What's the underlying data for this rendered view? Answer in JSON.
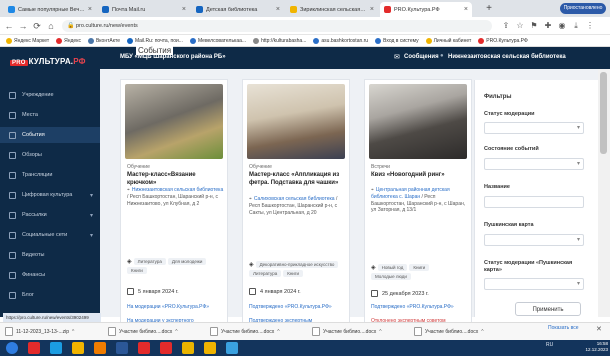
{
  "browser": {
    "tabs": [
      {
        "title": "Самые популярные Вечный эл",
        "color": "#1e88e5"
      },
      {
        "title": "Почта Mail.ru",
        "color": "#1565c0"
      },
      {
        "title": "Детская библиотека",
        "color": "#1565c0"
      },
      {
        "title": "Зириклинская сельская модел",
        "color": "#f0b400"
      },
      {
        "title": "PRO.Культура.РФ",
        "color": "#e32b2b"
      }
    ],
    "new_tab": "+",
    "url": "pro.culture.ru/new/events",
    "profile_label": "Приостановлено",
    "bookmarks": [
      {
        "label": "Яндекс Маркет",
        "color": "#f0b400"
      },
      {
        "label": "Яндекс",
        "color": "#e32b2b"
      },
      {
        "label": "ВконтАкте",
        "color": "#4a76a8"
      },
      {
        "label": "Mail.Ru: почта, пои...",
        "color": "#1565c0"
      },
      {
        "label": "Мевелсователькаа...",
        "color": "#2a6ec7"
      },
      {
        "label": "http://kulturabasha...",
        "color": "#888"
      },
      {
        "label": "asu.bashkortostan.ru",
        "color": "#2a6ec7"
      },
      {
        "label": "Вход в систему",
        "color": "#2a6ec7"
      },
      {
        "label": "Личный кабинет",
        "color": "#f0b400"
      },
      {
        "label": "PRO.Культура.РФ",
        "color": "#e32b2b"
      }
    ]
  },
  "app": {
    "logo_pro": "PRO",
    "logo_main": "КУЛЬТУРА.",
    "logo_rf": "РФ",
    "section_title": "События",
    "organization": "МБУ «МЦБ Шаранского района РБ»",
    "messages_label": "Сообщения",
    "user_org": "Нижнезаитовская сельская библиотека"
  },
  "sidebar": {
    "items": [
      {
        "label": "Учреждение",
        "active": false,
        "chevron": false
      },
      {
        "label": "Места",
        "active": false,
        "chevron": false
      },
      {
        "label": "События",
        "active": true,
        "chevron": false
      },
      {
        "label": "Обзоры",
        "active": false,
        "chevron": false
      },
      {
        "label": "Трансляции",
        "active": false,
        "chevron": false
      },
      {
        "label": "Цифровая культура",
        "active": false,
        "chevron": true
      },
      {
        "label": "Рассылки",
        "active": false,
        "chevron": true
      },
      {
        "label": "Социальные сети",
        "active": false,
        "chevron": true
      },
      {
        "label": "Видеоты",
        "active": false,
        "chevron": false
      },
      {
        "label": "Финансы",
        "active": false,
        "chevron": false
      },
      {
        "label": "Блог",
        "active": false,
        "chevron": false
      }
    ]
  },
  "cards": [
    {
      "category": "Обучение",
      "title": "Мастер-класс«Вязание крючком»",
      "address_link": "Нижнезаитовская сельская библиотека",
      "address": " / Респ Башкортостан, Шаранский р-н, с Нижнезаитово, ул Клубная, д 2",
      "tags": [
        "Литература",
        "Для молодежи",
        "Книги"
      ],
      "date": "5 января 2024 г.",
      "status_1": "На модерации «PRO.Культура.РФ»",
      "status_2": "На модерации у экспертного",
      "status_2_red": false
    },
    {
      "category": "Обучение",
      "title": "Мастер-класс «Аппликация из фетра. Подставка для чашки»",
      "address_link": "Салиховская сельская библиотека",
      "address": " / Респ Башкортостан, Шаранский р-н, с Сакты, ул Центральная, д 20",
      "tags": [
        "Декоративно-прикладное искусство",
        "Литература",
        "Книги"
      ],
      "date": "4 января 2024 г.",
      "status_1": "Подтверждено «PRO.Культура.РФ»",
      "status_2": "Подтверждено экспертным",
      "status_2_red": false
    },
    {
      "category": "Встречи",
      "title": "Квиз «Новогодний ринг»",
      "address_link": "Центральная районная детская библиотека с. Шаран",
      "address": " / Респ Башкортостан, Шаранский р-н, с Шаран, ул Заторная, д 13/1",
      "tags": [
        "Новый год",
        "Книги",
        "Молодые люди"
      ],
      "date": "25 декабря 2023 г.",
      "status_1": "Подтверждено «PRO.Культура.РФ»",
      "status_2": "Отклонено экспертным советом «Пушкинской карты»",
      "status_2_red": true
    }
  ],
  "filters": {
    "title": "Фильтры",
    "moderation_status": "Статус модерации",
    "event_status": "Состояние событий",
    "name": "Название",
    "pushkin_card": "Пушкинская карта",
    "pushkin_moderation": "Статус модерации «Пушкинская карта»",
    "apply_label": "Применить"
  },
  "status_bar": {
    "url": "https://pro.culture.ru/new/events/3902499"
  },
  "downloads": {
    "items": [
      "11-12-2023_13-13-...zip",
      "Участие библио....docx",
      "Участие библио....docx",
      "Участие библио....docx",
      "Участие библио....docx"
    ],
    "show_all": "Показать все"
  },
  "taskbar": {
    "time": "16:58",
    "date": "12.12.2023",
    "lang": "RU",
    "apps": [
      {
        "name": "start-orb",
        "color": "#2f7de1"
      },
      {
        "name": "yandex-browser",
        "color": "#e32b2b"
      },
      {
        "name": "ie",
        "color": "#1b9de2"
      },
      {
        "name": "explorer",
        "color": "#f0b400"
      },
      {
        "name": "media-player",
        "color": "#f07c00"
      },
      {
        "name": "word",
        "color": "#2b5797"
      },
      {
        "name": "opera",
        "color": "#e32b2b"
      },
      {
        "name": "yandex",
        "color": "#e32b2b"
      },
      {
        "name": "chrome",
        "color": "#e9b400"
      },
      {
        "name": "photo",
        "color": "#f0b400"
      },
      {
        "name": "paint",
        "color": "#3aa1e0"
      }
    ]
  }
}
